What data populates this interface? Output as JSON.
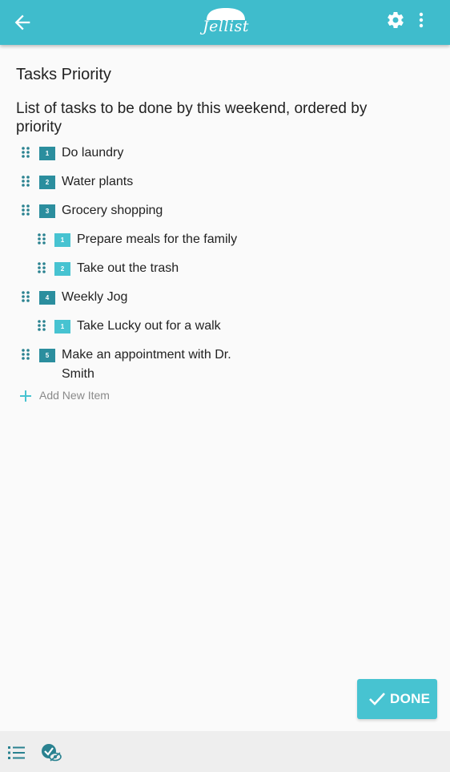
{
  "appbar": {
    "logo_text": "Jellist",
    "icons": [
      "arrow-back-icon",
      "gear-icon",
      "more-vert-icon"
    ]
  },
  "list": {
    "title": "Tasks Priority",
    "description": "List of tasks to be done by this weekend, ordered by priority",
    "items": [
      {
        "number": "1",
        "label": "Do laundry",
        "level": 0
      },
      {
        "number": "2",
        "label": "Water plants",
        "level": 0
      },
      {
        "number": "3",
        "label": "Grocery shopping",
        "level": 0
      },
      {
        "number": "1",
        "label": "Prepare meals for the family",
        "level": 1
      },
      {
        "number": "2",
        "label": "Take out the trash",
        "level": 1
      },
      {
        "number": "4",
        "label": "Weekly Jog",
        "level": 0
      },
      {
        "number": "1",
        "label": "Take Lucky out for a walk",
        "level": 1
      },
      {
        "number": "5",
        "label": "Make an appointment with Dr. Smith",
        "level": 0
      }
    ],
    "add_item_label": "Add New Item"
  },
  "done_button": {
    "label": "DONE"
  },
  "bottombar": {
    "icons": [
      "list-view-icon",
      "hide-completed-icon"
    ]
  },
  "colors": {
    "primary": "#3fbccc",
    "accent": "#47c3d1",
    "badge_dark": "#2b8e9e",
    "handle": "#2a8290"
  }
}
